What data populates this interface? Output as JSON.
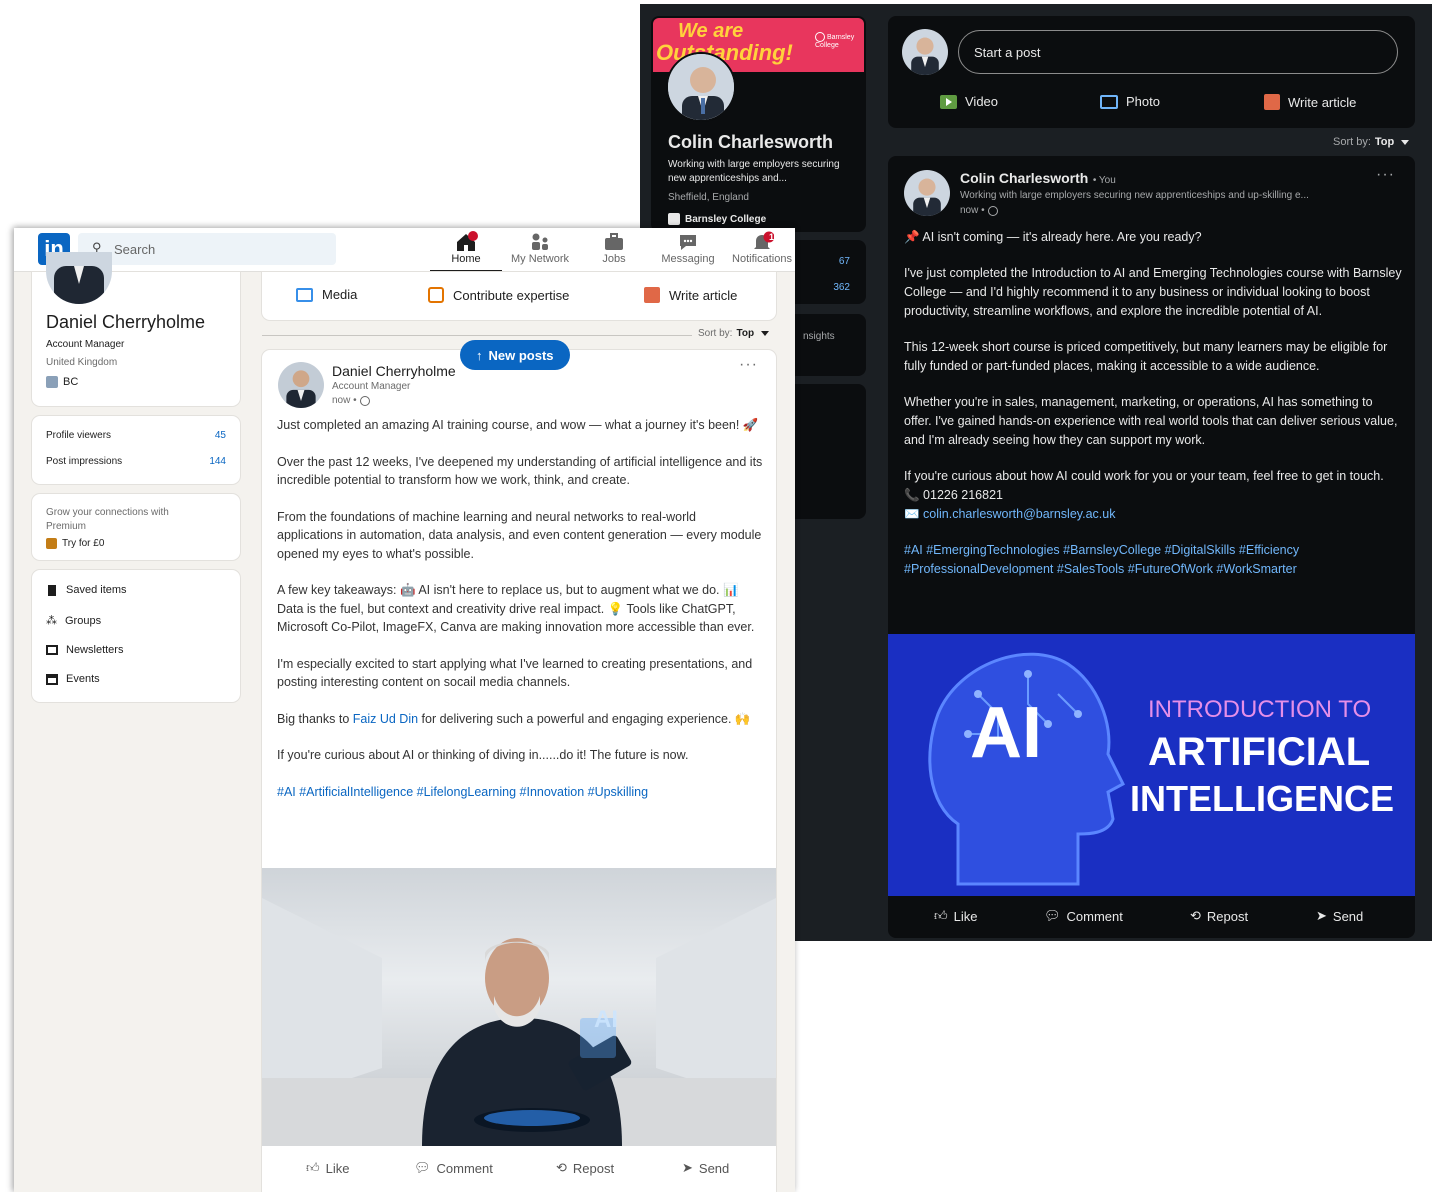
{
  "dark": {
    "banner": {
      "line1": "We are",
      "line2": "Outstanding!",
      "college_logo": "Barnsley College"
    },
    "profile": {
      "name": "Colin Charlesworth",
      "headline": "Working with large employers securing new apprenticeships and...",
      "location": "Sheffield, England",
      "org": "Barnsley College"
    },
    "stats": [
      "67",
      "362"
    ],
    "insights_partial": "nsights",
    "composer": {
      "placeholder": "Start a post",
      "video": "Video",
      "photo": "Photo",
      "write_article": "Write article"
    },
    "sort": {
      "label": "Sort by:",
      "value": "Top"
    },
    "post": {
      "author": "Colin Charlesworth",
      "you": "• You",
      "headline": "Working with large employers securing new apprenticeships and up-skilling e...",
      "time": "now •",
      "p1": "AI isn't coming — it's already here. Are you ready?",
      "p2": "I've just completed the Introduction to AI and Emerging Technologies course with Barnsley College — and I'd highly recommend it to any business or individual looking to boost productivity, streamline workflows, and explore the incredible potential of AI.",
      "p3": "This 12-week short course is priced competitively, but many learners may be eligible for fully funded or part-funded places, making it accessible to a wide audience.",
      "p4": "Whether you're in sales, management, marketing, or operations, AI has something to offer. I've gained hands-on experience with real world tools that can deliver serious value, and I'm already seeing how they can support my work.",
      "p5": "If you're curious about how AI could work for you or your team, feel free to get in touch.",
      "phone": "01226 216821",
      "email": "colin.charlesworth@barnsley.ac.uk",
      "hashtags1": "#AI #EmergingTechnologies #BarnsleyCollege #DigitalSkills #Efficiency",
      "hashtags2": "#ProfessionalDevelopment #SalesTools #FutureOfWork #WorkSmarter",
      "image": {
        "big": "AI",
        "line1": "INTRODUCTION TO",
        "line2": "ARTIFICIAL",
        "line3": "INTELLIGENCE"
      },
      "actions": {
        "like": "Like",
        "comment": "Comment",
        "repost": "Repost",
        "send": "Send"
      }
    }
  },
  "light": {
    "search_placeholder": "Search",
    "nav": [
      {
        "label": "Home",
        "icon": "home-icon"
      },
      {
        "label": "My Network",
        "icon": "network-icon"
      },
      {
        "label": "Jobs",
        "icon": "jobs-icon"
      },
      {
        "label": "Messaging",
        "icon": "messaging-icon"
      },
      {
        "label": "Notifications",
        "icon": "bell-icon",
        "badge": "1"
      }
    ],
    "profile": {
      "name": "Daniel Cherryholme",
      "title": "Account Manager",
      "location": "United Kingdom",
      "org": "BC"
    },
    "stats": [
      {
        "label": "Profile viewers",
        "value": "45"
      },
      {
        "label": "Post impressions",
        "value": "144"
      }
    ],
    "premium": {
      "text": "Grow your connections with Premium",
      "cta": "Try for £0"
    },
    "shortcuts": [
      "Saved items",
      "Groups",
      "Newsletters",
      "Events"
    ],
    "composer": {
      "media": "Media",
      "contribute": "Contribute expertise",
      "write_article": "Write article"
    },
    "sort": {
      "label": "Sort by:",
      "value": "Top"
    },
    "new_posts": "New posts",
    "post": {
      "author": "Daniel Cherryholme",
      "title": "Account Manager",
      "time": "now •",
      "p1": "Just completed an amazing AI training course, and wow — what a journey it's been! 🚀",
      "p2": "Over the past 12 weeks, I've deepened my understanding of artificial intelligence and its incredible potential to transform how we work, think, and create.",
      "p3": "From the foundations of machine learning and neural networks to real-world applications in automation, data analysis, and even content generation — every module opened my eyes to what's possible.",
      "p4": "A few key takeaways: 🤖 AI isn't here to replace us, but to augment what we do. 📊 Data is the fuel, but context and creativity drive real impact. 💡 Tools like ChatGPT, Microsoft Co-Pilot, ImageFX, Canva are making innovation more accessible than ever.",
      "p5": "I'm especially excited to start applying what I've learned to creating presentations, and posting interesting content on socail media channels.",
      "p6_pre": "Big thanks to ",
      "p6_link": "Faiz Ud Din",
      "p6_post": " for delivering such a powerful and engaging experience. 🙌",
      "p7": "If you're curious about AI or thinking of diving in......do it! The future is now.",
      "hashtags": "#AI #ArtificialIntelligence #LifelongLearning #Innovation #Upskilling",
      "image_text": "AI",
      "actions": {
        "like": "Like",
        "comment": "Comment",
        "repost": "Repost",
        "send": "Send"
      }
    }
  },
  "colors": {
    "linkedin_blue": "#0a66c2",
    "dark_link": "#71b7fb",
    "banner_pink": "#e8365d",
    "banner_yellow": "#ffd23c",
    "ai_blue": "#1a2fc2"
  }
}
